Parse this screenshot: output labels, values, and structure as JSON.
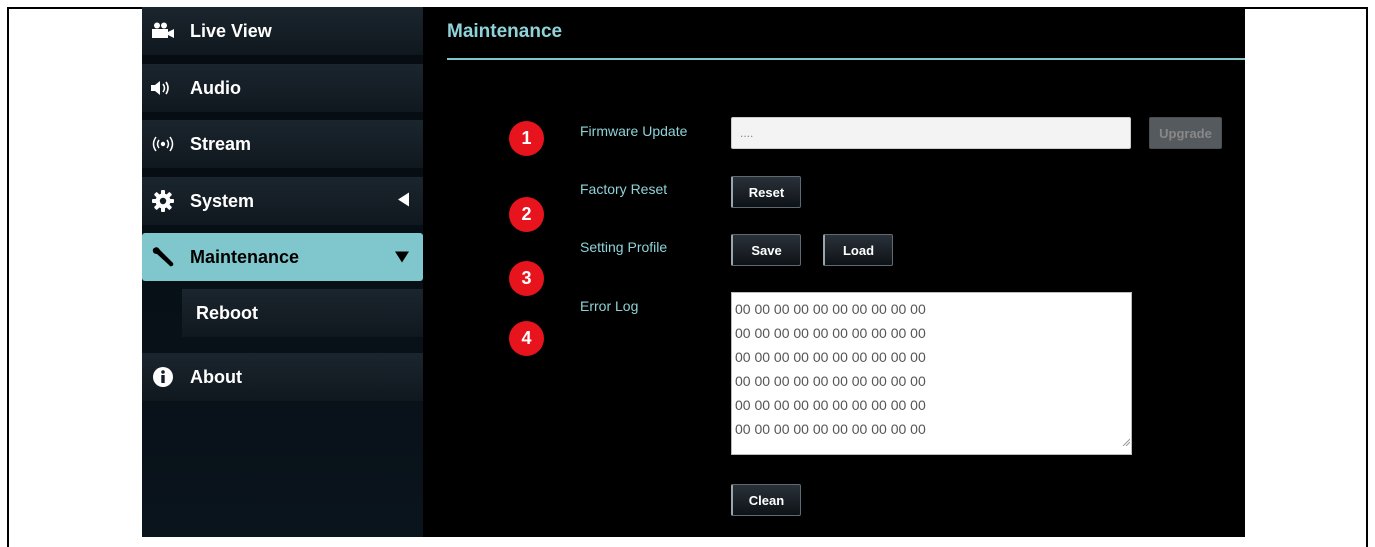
{
  "sidebar": {
    "items": [
      {
        "label": "Live View",
        "icon": "camera-icon"
      },
      {
        "label": "Audio",
        "icon": "speaker-icon"
      },
      {
        "label": "Stream",
        "icon": "broadcast-icon"
      },
      {
        "label": "System",
        "icon": "gear-icon"
      },
      {
        "label": "Maintenance",
        "icon": "wrench-icon"
      },
      {
        "label": "About",
        "icon": "info-icon"
      }
    ],
    "sub_items": [
      {
        "label": "Reboot"
      }
    ]
  },
  "page": {
    "title": "Maintenance"
  },
  "badges": [
    "1",
    "2",
    "3",
    "4"
  ],
  "firmware": {
    "label": "Firmware Update",
    "field_value": "....",
    "upgrade_label": "Upgrade"
  },
  "factory_reset": {
    "label": "Factory Reset",
    "reset_label": "Reset"
  },
  "setting_profile": {
    "label": "Setting Profile",
    "save_label": "Save",
    "load_label": "Load"
  },
  "error_log": {
    "label": "Error Log",
    "lines": [
      "00 00 00 00 00 00 00 00 00 00",
      "00 00 00 00 00 00 00 00 00 00",
      "00 00 00 00 00 00 00 00 00 00",
      "00 00 00 00 00 00 00 00 00 00",
      "00 00 00 00 00 00 00 00 00 00",
      "00 00 00 00 00 00 00 00 00 00"
    ],
    "clean_label": "Clean"
  },
  "colors": {
    "accent": "#7fc7cc",
    "badge": "#e8141d",
    "background": "#000000"
  }
}
